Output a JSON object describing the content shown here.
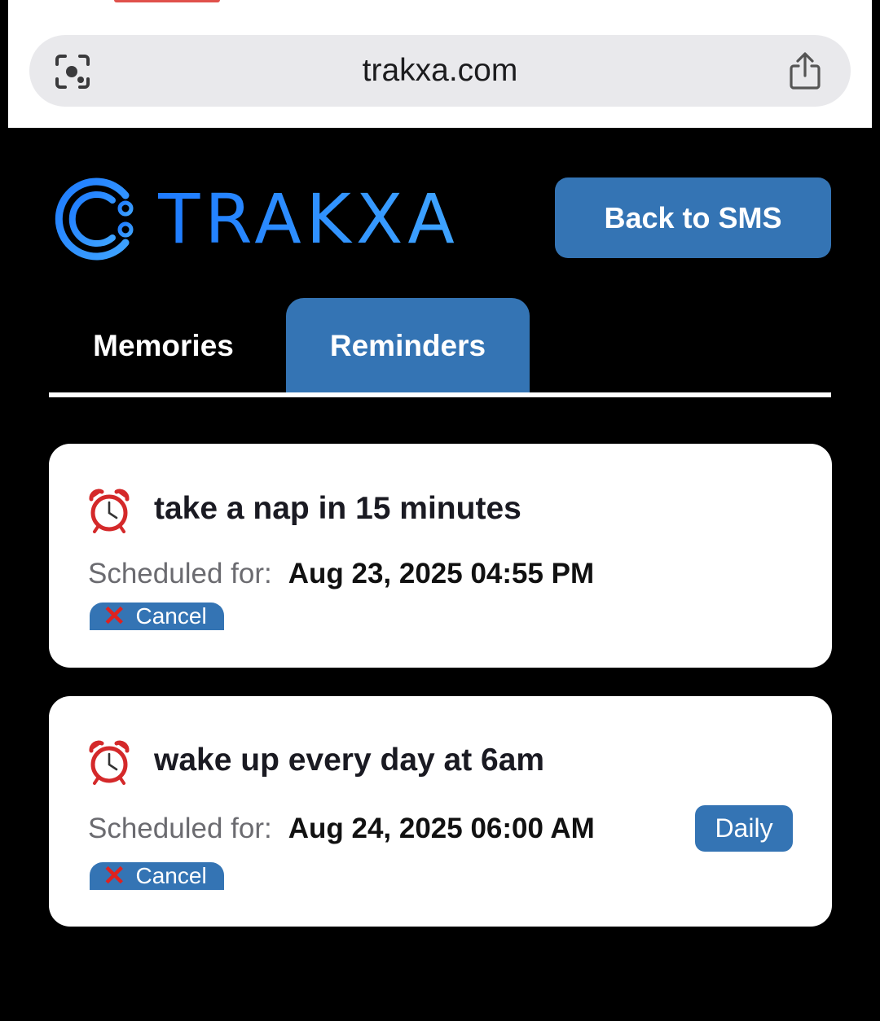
{
  "browser": {
    "url": "trakxa.com",
    "lens_icon": "visual-lookup-icon",
    "share_icon": "share-icon"
  },
  "header": {
    "brand": "TRAKXA",
    "back_button": "Back to SMS",
    "brand_color": "#2f8ff6",
    "accent_color": "#3474b4"
  },
  "tabs": [
    {
      "label": "Memories",
      "active": false
    },
    {
      "label": "Reminders",
      "active": true
    }
  ],
  "reminders": [
    {
      "icon": "alarm-clock-icon",
      "title": "take a nap in 15 minutes",
      "scheduled_label": "Scheduled for:",
      "scheduled_value": "Aug 23, 2025 04:55 PM",
      "cancel_label": "Cancel",
      "badge": ""
    },
    {
      "icon": "alarm-clock-icon",
      "title": "wake up every day at 6am",
      "scheduled_label": "Scheduled for:",
      "scheduled_value": "Aug 24, 2025 06:00 AM",
      "cancel_label": "Cancel",
      "badge": "Daily"
    }
  ]
}
